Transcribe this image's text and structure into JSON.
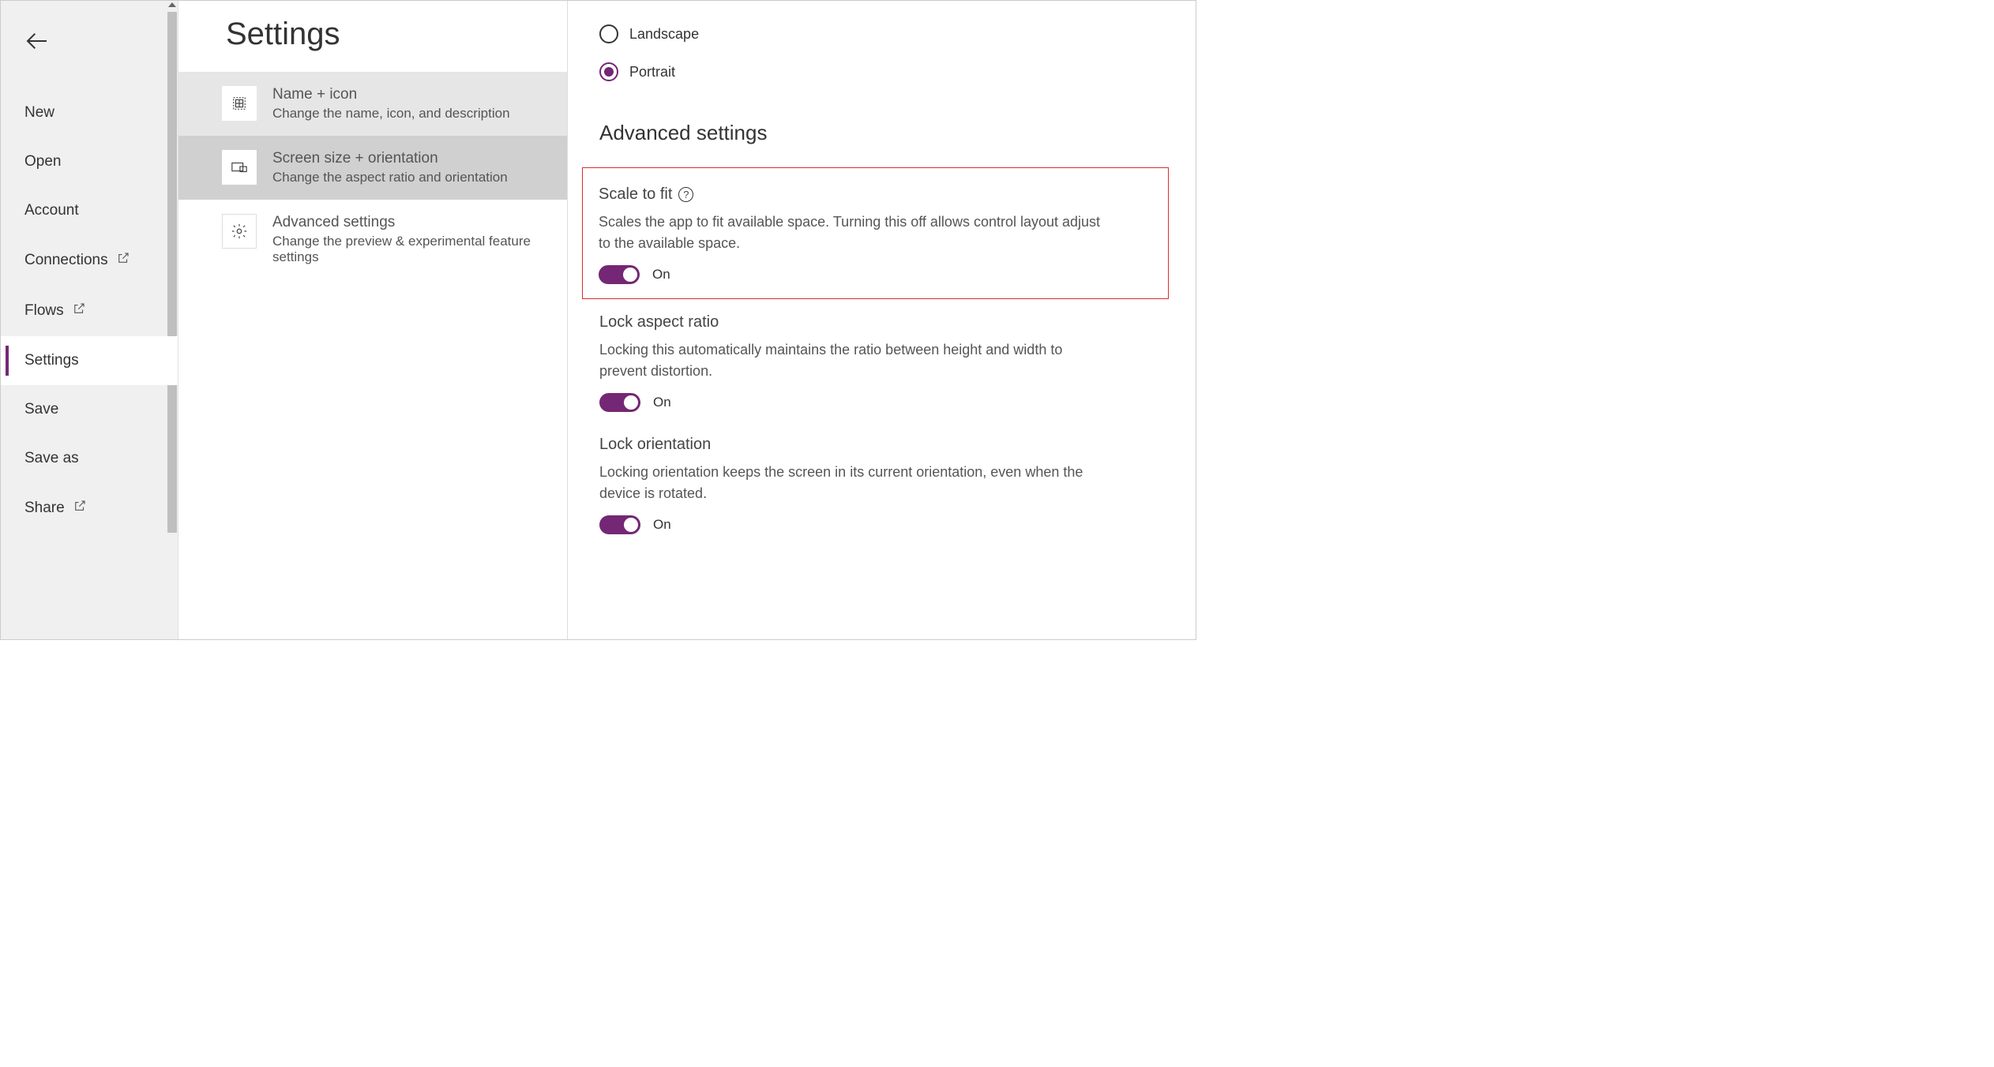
{
  "sidebar": {
    "items": [
      {
        "label": "New"
      },
      {
        "label": "Open"
      },
      {
        "label": "Account"
      },
      {
        "label": "Connections"
      },
      {
        "label": "Flows"
      },
      {
        "label": "Settings"
      },
      {
        "label": "Save"
      },
      {
        "label": "Save as"
      },
      {
        "label": "Share"
      }
    ]
  },
  "main": {
    "title": "Settings",
    "categories": [
      {
        "title": "Name + icon",
        "desc": "Change the name, icon, and description"
      },
      {
        "title": "Screen size + orientation",
        "desc": "Change the aspect ratio and orientation"
      },
      {
        "title": "Advanced settings",
        "desc": "Change the preview & experimental feature settings"
      }
    ]
  },
  "detail": {
    "orientation": {
      "landscape": "Landscape",
      "portrait": "Portrait"
    },
    "advanced_heading": "Advanced settings",
    "scale_to_fit": {
      "title": "Scale to fit",
      "desc": "Scales the app to fit available space. Turning this off allows control layout adjust to the available space.",
      "state": "On"
    },
    "lock_aspect": {
      "title": "Lock aspect ratio",
      "desc": "Locking this automatically maintains the ratio between height and width to prevent distortion.",
      "state": "On"
    },
    "lock_orientation": {
      "title": "Lock orientation",
      "desc": "Locking orientation keeps the screen in its current orientation, even when the device is rotated.",
      "state": "On"
    }
  }
}
